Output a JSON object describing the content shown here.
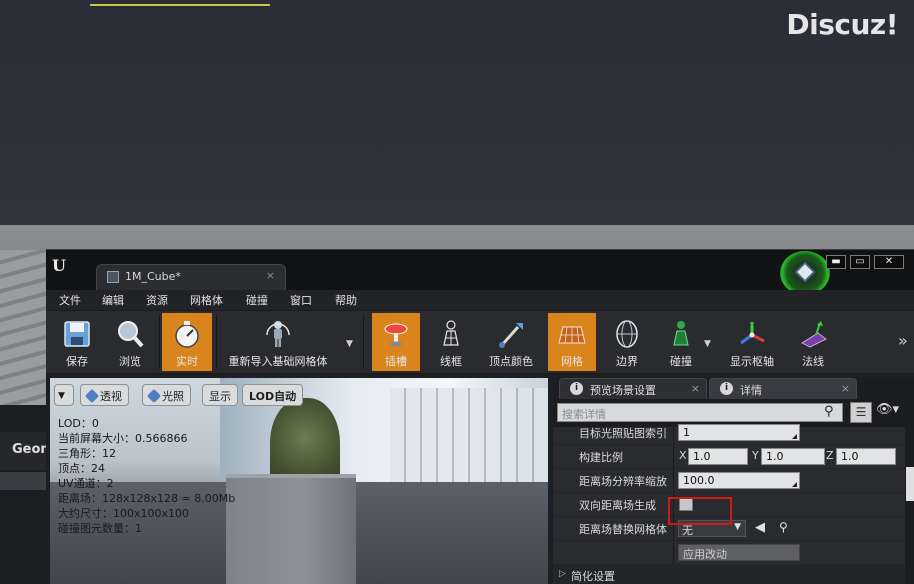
{
  "watermark": "Discuz!",
  "left_panel": {
    "tab_label": "Geom"
  },
  "window": {
    "tab_title": "1M_Cube*",
    "tab_close": "×",
    "controls": {
      "minimize": "▬",
      "maximize": "▭",
      "close": "✕"
    }
  },
  "menu": [
    "文件",
    "编辑",
    "资源",
    "网格体",
    "碰撞",
    "窗口",
    "帮助"
  ],
  "toolbar": {
    "save": "保存",
    "browse": "浏览",
    "realtime": "实时",
    "reimport": "重新导入基础网格体",
    "sockets": "插槽",
    "wireframe": "线框",
    "vertex_colors": "顶点颜色",
    "grid": "网格",
    "bounds": "边界",
    "collision": "碰撞",
    "show_pivot": "显示枢轴",
    "normals": "法线",
    "overflow": "»"
  },
  "viewport": {
    "buttons": {
      "perspective": "透视",
      "lit": "光照",
      "show": "显示",
      "lod": "LOD自动"
    },
    "stats": [
      "LOD：0",
      "当前屏幕大小：0.566866",
      "三角形：12",
      "顶点：24",
      "UV通道：2",
      "距离场：128x128x128 = 8.00Mb",
      "大约尺寸：100x100x100",
      "碰撞图元数量：1"
    ]
  },
  "panel": {
    "tabs": {
      "preview_scene": "预览场景设置",
      "details": "详情"
    },
    "search_placeholder": "搜索详情",
    "rows": {
      "lightmap_index_label": "目标光照贴图索引",
      "lightmap_index_value": "1",
      "build_scale_label": "构建比例",
      "scale_x": "1.0",
      "scale_y": "1.0",
      "scale_z": "1.0",
      "axis_x": "X",
      "axis_y": "Y",
      "axis_z": "Z",
      "df_resolution_label": "距离场分辨率缩放",
      "df_resolution_value": "100.0",
      "two_sided_df_label": "双向距离场生成",
      "df_replacement_label": "距离场替换网格体",
      "df_replacement_value": "无",
      "apply_changes": "应用改动"
    },
    "section_simplify": "简化设置"
  }
}
